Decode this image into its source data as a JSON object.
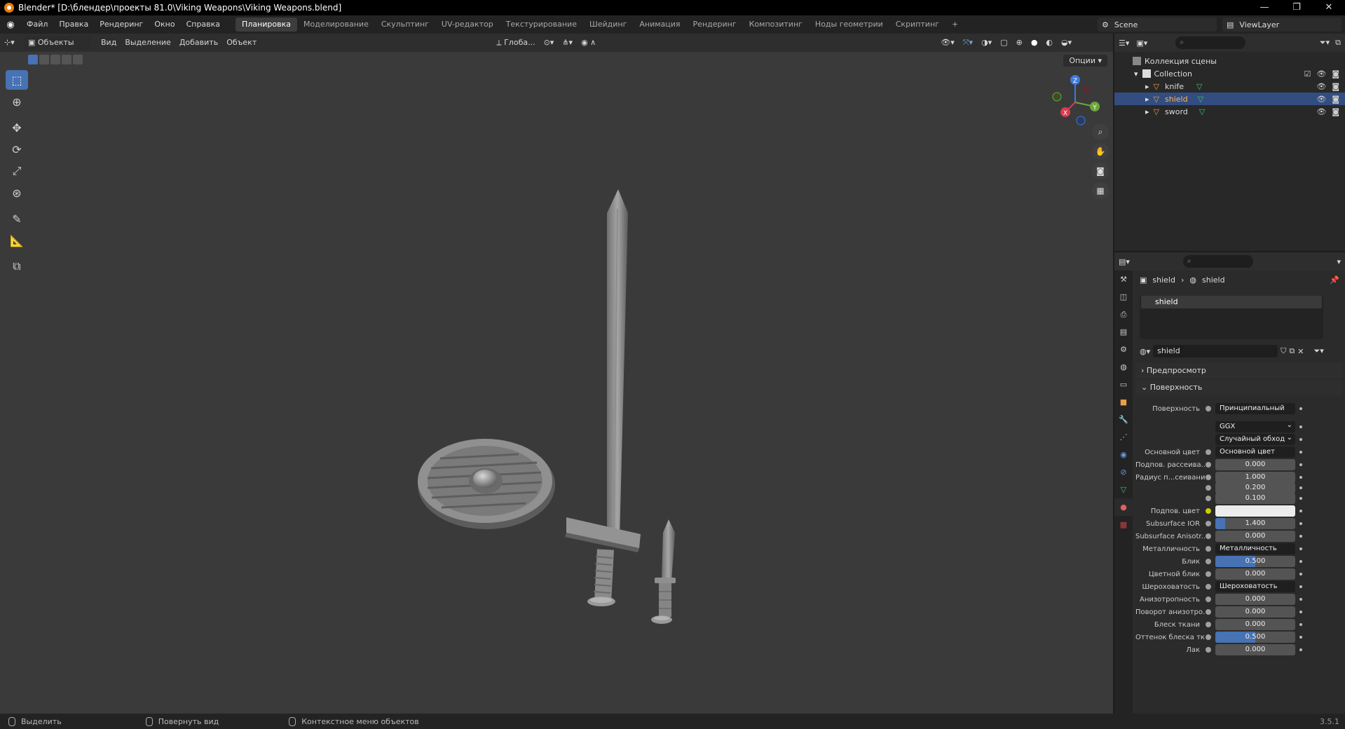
{
  "window": {
    "title": "Blender* [D:\\блендер\\проекты 81.0\\Viking Weapons\\Viking Weapons.blend]",
    "controls": [
      "—",
      "❐",
      "✕"
    ]
  },
  "menu": {
    "items": [
      "Файл",
      "Правка",
      "Рендеринг",
      "Окно",
      "Справка"
    ]
  },
  "workspaces": {
    "tabs": [
      "Планировка",
      "Моделирование",
      "Скульптинг",
      "UV-редактор",
      "Текстурирование",
      "Шейдинг",
      "Анимация",
      "Рендеринг",
      "Композитинг",
      "Ноды геометрии",
      "Скриптинг",
      "+"
    ],
    "active": "Планировка"
  },
  "scene": {
    "name": "Scene",
    "view_layer": "ViewLayer"
  },
  "viewport": {
    "mode": "Объекты",
    "menus": [
      "Вид",
      "Выделение",
      "Добавить",
      "Объект"
    ],
    "orientation": "Глоба...",
    "options_label": "Опции",
    "gizmo": {
      "x": "X",
      "y": "Y",
      "z": "Z"
    },
    "objects": [
      "shield",
      "sword",
      "knife"
    ]
  },
  "tools": [
    "select-box",
    "cursor",
    "move",
    "rotate",
    "scale",
    "transform",
    "annotate",
    "measure",
    "add-cube"
  ],
  "outliner": {
    "scene_collection": "Коллекция сцены",
    "collection": "Collection",
    "objects": [
      {
        "name": "knife",
        "selected": false
      },
      {
        "name": "shield",
        "selected": true
      },
      {
        "name": "sword",
        "selected": false
      }
    ]
  },
  "properties": {
    "breadcrumb": [
      "shield",
      "shield"
    ],
    "slot": "shield",
    "material_name": "shield",
    "panels": {
      "preview": "Предпросмотр",
      "surface": "Поверхность"
    },
    "rows": [
      {
        "label": "Поверхность",
        "value": "Принципиальный BSDF",
        "kind": "link"
      },
      {
        "label": "",
        "value": "GGX",
        "kind": "select"
      },
      {
        "label": "",
        "value": "Случайный обход",
        "kind": "select"
      },
      {
        "label": "Основной цвет",
        "value": "Основной цвет",
        "kind": "link"
      },
      {
        "label": "Подпов. рассеива...",
        "value": "0.000",
        "kind": "num",
        "fill": 0
      },
      {
        "label": "Радиус п...сеивания",
        "value": "1.000",
        "kind": "num",
        "fill": 0
      },
      {
        "label": "",
        "value": "0.200",
        "kind": "num",
        "fill": 0
      },
      {
        "label": "",
        "value": "0.100",
        "kind": "num",
        "fill": 0
      },
      {
        "label": "Подпов. цвет",
        "value": "",
        "kind": "color"
      },
      {
        "label": "Subsurface IOR",
        "value": "1.400",
        "kind": "num",
        "fill": 0.12
      },
      {
        "label": "Subsurface Anisotr...",
        "value": "0.000",
        "kind": "num",
        "fill": 0
      },
      {
        "label": "Металличность",
        "value": "Металличность",
        "kind": "link"
      },
      {
        "label": "Блик",
        "value": "0.500",
        "kind": "num",
        "fill": 0.5
      },
      {
        "label": "Цветной блик",
        "value": "0.000",
        "kind": "num",
        "fill": 0
      },
      {
        "label": "Шероховатость",
        "value": "Шероховатость",
        "kind": "link"
      },
      {
        "label": "Анизотропность",
        "value": "0.000",
        "kind": "num",
        "fill": 0
      },
      {
        "label": "Поворот анизотро...",
        "value": "0.000",
        "kind": "num",
        "fill": 0
      },
      {
        "label": "Блеск ткани",
        "value": "0.000",
        "kind": "num",
        "fill": 0
      },
      {
        "label": "Оттенок блеска тк...",
        "value": "0.500",
        "kind": "num",
        "fill": 0.5
      },
      {
        "label": "Лак",
        "value": "0.000",
        "kind": "num",
        "fill": 0
      }
    ]
  },
  "status": {
    "items": [
      "Выделить",
      "Повернуть вид",
      "Контекстное меню объектов"
    ],
    "version": "3.5.1"
  },
  "colors": {
    "accent": "#4772b3",
    "selected_row": "#334d80",
    "viewport_bg": "#3a3a3a"
  }
}
